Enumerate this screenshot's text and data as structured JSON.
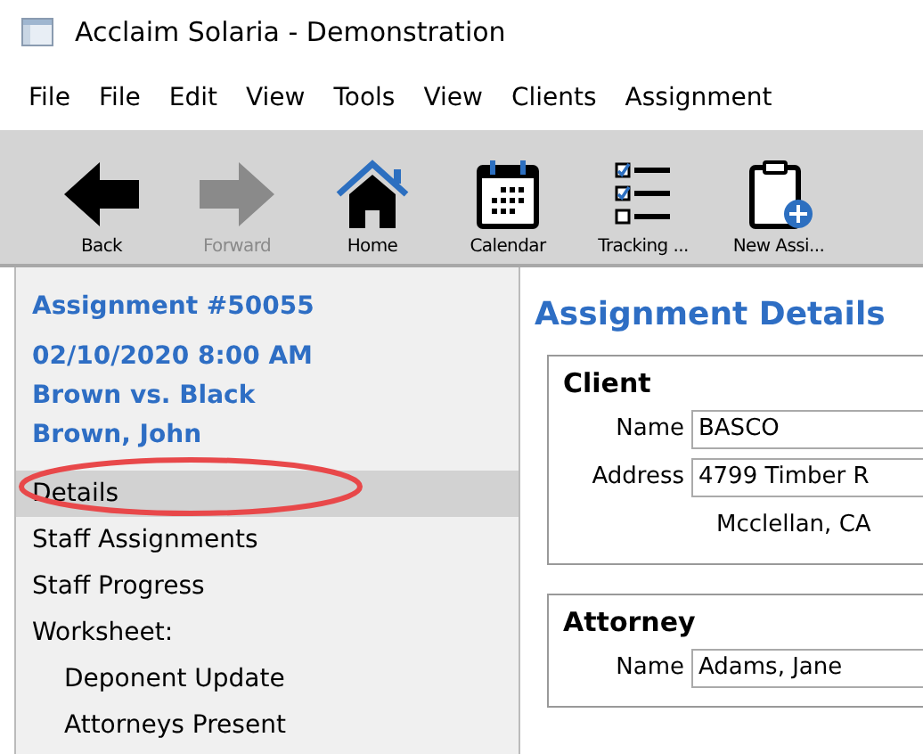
{
  "window": {
    "title": "Acclaim Solaria - Demonstration"
  },
  "menu": [
    "File",
    "File",
    "Edit",
    "View",
    "Tools",
    "View",
    "Clients",
    "Assignment"
  ],
  "toolbar": [
    {
      "kind": "back",
      "label": "Back",
      "disabled": false
    },
    {
      "kind": "forward",
      "label": "Forward",
      "disabled": true
    },
    {
      "kind": "home",
      "label": "Home",
      "disabled": false
    },
    {
      "kind": "calendar",
      "label": "Calendar",
      "disabled": false
    },
    {
      "kind": "tracking",
      "label": "Tracking ...",
      "disabled": false
    },
    {
      "kind": "new",
      "label": "New Assi...",
      "disabled": false
    }
  ],
  "sidebar": {
    "title": "Assignment #50055",
    "info": [
      "02/10/2020  8:00 AM",
      "Brown vs. Black",
      "Brown, John"
    ],
    "items": [
      {
        "label": "Details",
        "selected": true
      },
      {
        "label": "Staff Assignments",
        "selected": false
      },
      {
        "label": "Staff Progress",
        "selected": false
      },
      {
        "label": "Worksheet:",
        "selected": false,
        "children": [
          {
            "label": "Deponent Update",
            "selected": false
          },
          {
            "label": "Attorneys Present",
            "selected": false
          }
        ]
      }
    ],
    "annotation": {
      "kind": "ellipse"
    }
  },
  "content": {
    "title": "Assignment Details",
    "sections": [
      {
        "title": "Client",
        "fields": [
          {
            "label": "Name",
            "value": "BASCO"
          },
          {
            "label": "Address",
            "value": "4799 Timber R",
            "extra": "Mcclellan, CA"
          }
        ]
      },
      {
        "title": "Attorney",
        "fields": [
          {
            "label": "Name",
            "value": "Adams, Jane"
          }
        ]
      }
    ]
  }
}
